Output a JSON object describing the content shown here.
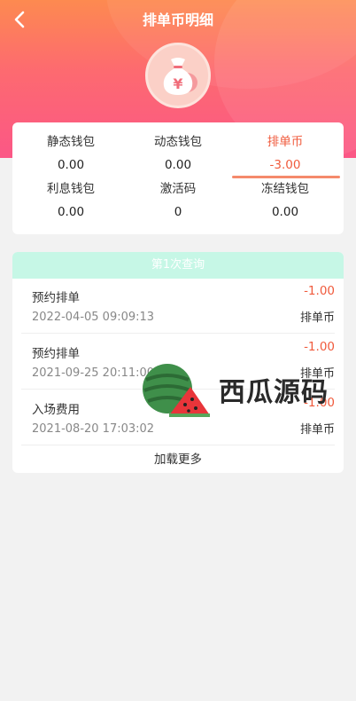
{
  "header": {
    "title": "排单币明细"
  },
  "wallets": [
    {
      "label": "静态钱包",
      "value": "0.00"
    },
    {
      "label": "动态钱包",
      "value": "0.00"
    },
    {
      "label": "排单币",
      "value": "-3.00"
    },
    {
      "label": "利息钱包",
      "value": "0.00"
    },
    {
      "label": "激活码",
      "value": "0"
    },
    {
      "label": "冻结钱包",
      "value": "0.00"
    }
  ],
  "records": {
    "query_label": "第1次查询",
    "items": [
      {
        "title": "预约排单",
        "date": "2022-04-05 09:09:13",
        "amount": "-1.00",
        "unit": "排单币"
      },
      {
        "title": "预约排单",
        "date": "2021-09-25 20:11:00",
        "amount": "-1.00",
        "unit": "排单币"
      },
      {
        "title": "入场费用",
        "date": "2021-08-20 17:03:02",
        "amount": "-1.00",
        "unit": "排单币"
      }
    ],
    "load_more": "加载更多"
  },
  "watermark": {
    "text": "西瓜源码"
  },
  "colors": {
    "accent": "#f05a3c",
    "header_gradient_top": "#fd8a50",
    "header_gradient_bottom": "#fb5786",
    "query_bar": "#c6f7e6"
  },
  "icons": {
    "back": "chevron-left-icon",
    "avatar": "money-bag-icon"
  }
}
